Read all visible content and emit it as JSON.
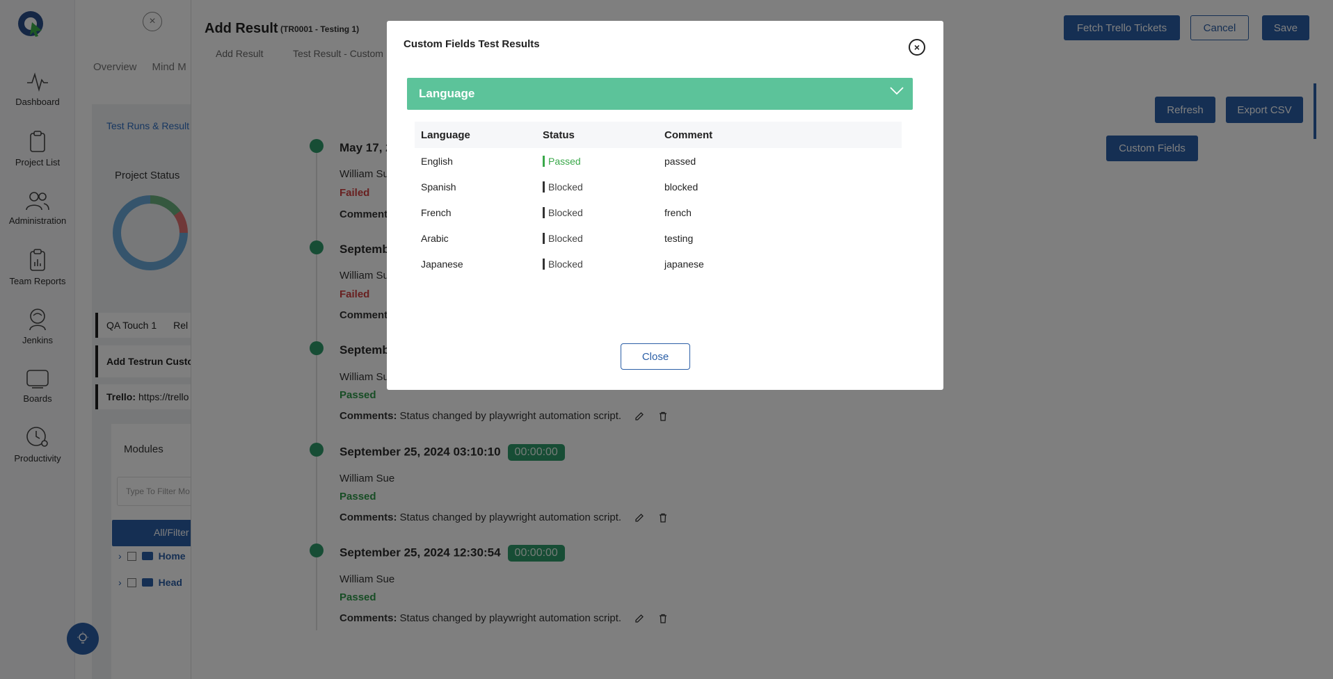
{
  "sidebar": {
    "items": [
      {
        "label": "Dashboard",
        "icon": "pulse-icon"
      },
      {
        "label": "Project List",
        "icon": "clipboard-icon"
      },
      {
        "label": "Administration",
        "icon": "users-icon"
      },
      {
        "label": "Team Reports",
        "icon": "report-icon"
      },
      {
        "label": "Jenkins",
        "icon": "jenkins-icon"
      },
      {
        "label": "Boards",
        "icon": "board-icon"
      },
      {
        "label": "Productivity",
        "icon": "clock-gear-icon"
      }
    ]
  },
  "background_page": {
    "tabs": [
      "Overview",
      "Mind M"
    ],
    "test_runs_link": "Test Runs & Result",
    "project_status": "Project Status",
    "card_qa": "QA Touch 1",
    "card_qa_rel": "Rel",
    "card_testrun": "Add Testrun Custo",
    "card_trello_label": "Trello:",
    "card_trello_value": "https://trello",
    "modules_title": "Modules",
    "modules_filter_placeholder": "Type To Filter Mo",
    "all_filter": "All/Filter",
    "tree": [
      "Home",
      "Head"
    ]
  },
  "drawer": {
    "title": "Add Result",
    "subtitle": "(TR0001 - Testing 1)",
    "tabs": [
      "Add Result",
      "Test Result - Custom"
    ],
    "buttons": {
      "fetch_trello": "Fetch Trello Tickets",
      "cancel": "Cancel",
      "save": "Save",
      "refresh": "Refresh",
      "export_csv": "Export CSV",
      "custom_fields": "Custom Fields"
    },
    "timeline": [
      {
        "date": "May 17, 2",
        "duration": "",
        "user": "William Su",
        "status": "Failed",
        "comment_label": "Comment",
        "comment": ""
      },
      {
        "date": "Septemb",
        "duration": "",
        "user": "William Su",
        "status": "Failed",
        "comment_label": "Comment",
        "comment": ""
      },
      {
        "date": "Septemb",
        "duration": "",
        "user": "William Su",
        "status": "Passed",
        "comment_label": "Comments:",
        "comment": "Status changed by playwright automation script."
      },
      {
        "date": "September 25, 2024 03:10:10",
        "duration": "00:00:00",
        "user": "William Sue",
        "status": "Passed",
        "comment_label": "Comments:",
        "comment": "Status changed by playwright automation script."
      },
      {
        "date": "September 25, 2024 12:30:54",
        "duration": "00:00:00",
        "user": "William Sue",
        "status": "Passed",
        "comment_label": "Comments:",
        "comment": "Status changed by playwright automation script."
      }
    ]
  },
  "modal": {
    "title": "Custom Fields Test Results",
    "accordion_title": "Language",
    "columns": [
      "Language",
      "Status",
      "Comment"
    ],
    "rows": [
      {
        "language": "English",
        "status": "Passed",
        "comment": "passed"
      },
      {
        "language": "Spanish",
        "status": "Blocked",
        "comment": "blocked"
      },
      {
        "language": "French",
        "status": "Blocked",
        "comment": "french"
      },
      {
        "language": "Arabic",
        "status": "Blocked",
        "comment": "testing"
      },
      {
        "language": "Japanese",
        "status": "Blocked",
        "comment": "japanese"
      }
    ],
    "close_button": "Close"
  },
  "colors": {
    "primary": "#2a5ea6",
    "accordion": "#5cc39a",
    "passed": "#2e9a4a",
    "failed": "#d04040",
    "blocked": "#333333",
    "duration_badge": "#2e9a6a"
  }
}
